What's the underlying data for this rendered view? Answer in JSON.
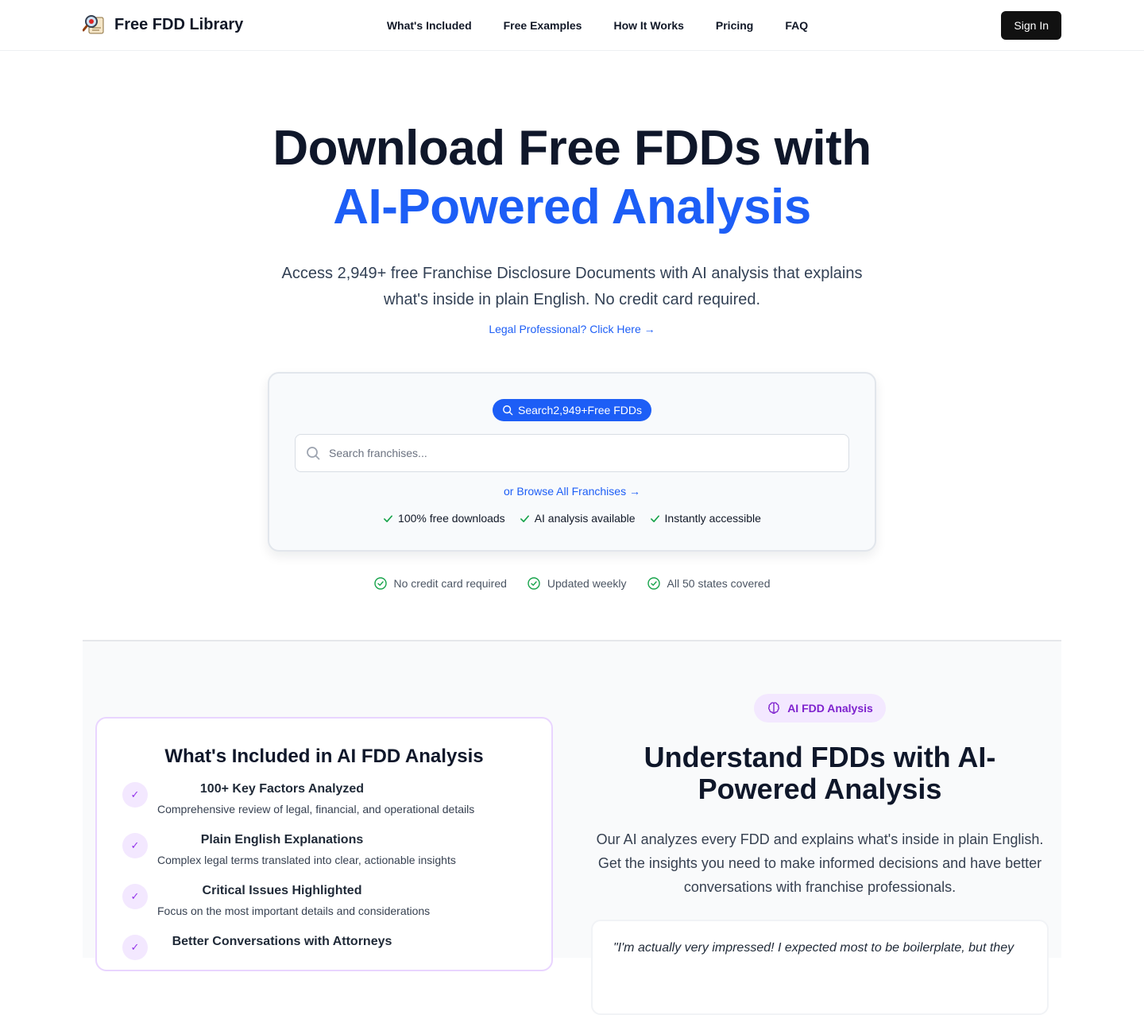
{
  "brand": {
    "name": "Free FDD Library",
    "logo_icon": "magnifier-document-icon"
  },
  "nav": {
    "links": [
      "What's Included",
      "Free Examples",
      "How It Works",
      "Pricing",
      "FAQ"
    ],
    "signin_label": "Sign In"
  },
  "hero": {
    "title_line1": "Download Free FDDs with",
    "title_line2": "AI-Powered Analysis",
    "subtitle": "Access 2,949+ free Franchise Disclosure Documents with AI analysis that explains what's inside in plain English. No credit card required.",
    "legal_link": "Legal Professional? Click Here →"
  },
  "search": {
    "pill_label": "Search2,949+Free FDDs",
    "placeholder": "Search franchises...",
    "browse_link": "or Browse All Franchises →",
    "features": [
      "100% free downloads",
      "AI analysis available",
      "Instantly accessible"
    ]
  },
  "trust": [
    "No credit card required",
    "Updated weekly",
    "All 50 states covered"
  ],
  "included": {
    "title": "What's Included in AI FDD Analysis",
    "items": [
      {
        "title": "100+ Key Factors Analyzed",
        "desc": "Comprehensive review of legal, financial, and operational details"
      },
      {
        "title": "Plain English Explanations",
        "desc": "Complex legal terms translated into clear, actionable insights"
      },
      {
        "title": "Critical Issues Highlighted",
        "desc": "Focus on the most important details and considerations"
      },
      {
        "title": "Better Conversations with Attorneys",
        "desc": ""
      }
    ]
  },
  "analysis": {
    "pill_label": "AI FDD Analysis",
    "title": "Understand FDDs with AI-Powered Analysis",
    "desc": "Our AI analyzes every FDD and explains what's inside in plain English. Get the insights you need to make informed decisions and have better conversations with franchise professionals.",
    "quote": "\"I'm actually very impressed! I expected most to be boilerplate, but they"
  },
  "colors": {
    "accent": "#1d5ef6",
    "purple": "#7e22ce",
    "check_green": "#16a34a"
  }
}
